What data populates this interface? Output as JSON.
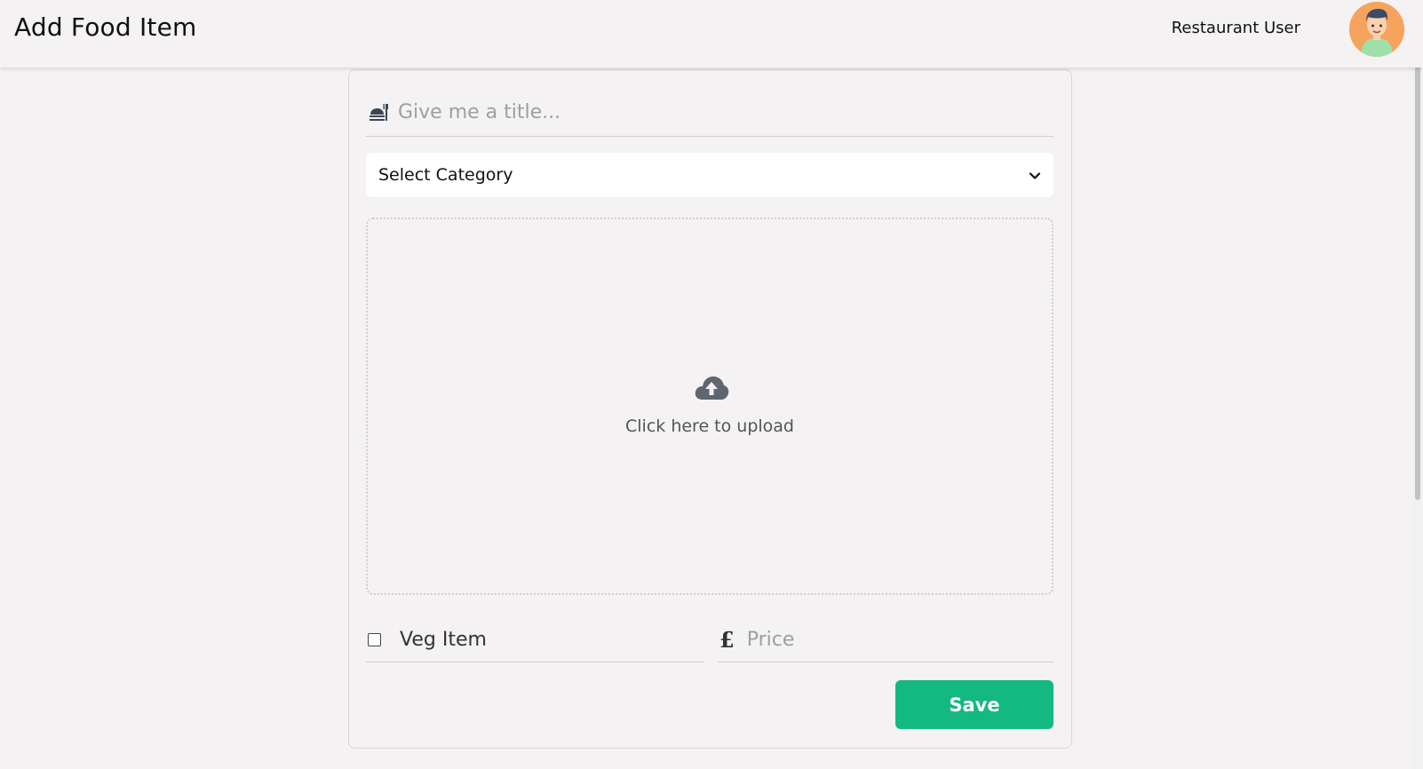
{
  "header": {
    "title": "Add Food Item",
    "user_name": "Restaurant User",
    "avatar_icon": "user-avatar-icon"
  },
  "form": {
    "title_placeholder": "Give me a title...",
    "title_value": "",
    "title_icon": "food-icon",
    "category_selected": "Select Category",
    "category_icon": "chevron-down-icon",
    "upload_text": "Click here to upload",
    "upload_icon": "cloud-upload-icon",
    "veg_label": "Veg Item",
    "veg_checked": false,
    "price_symbol": "£",
    "price_placeholder": "Price",
    "price_value": "",
    "save_label": "Save"
  },
  "colors": {
    "accent": "#13b981",
    "background": "#f4f2f3",
    "avatar_bg": "#f6a35e"
  }
}
